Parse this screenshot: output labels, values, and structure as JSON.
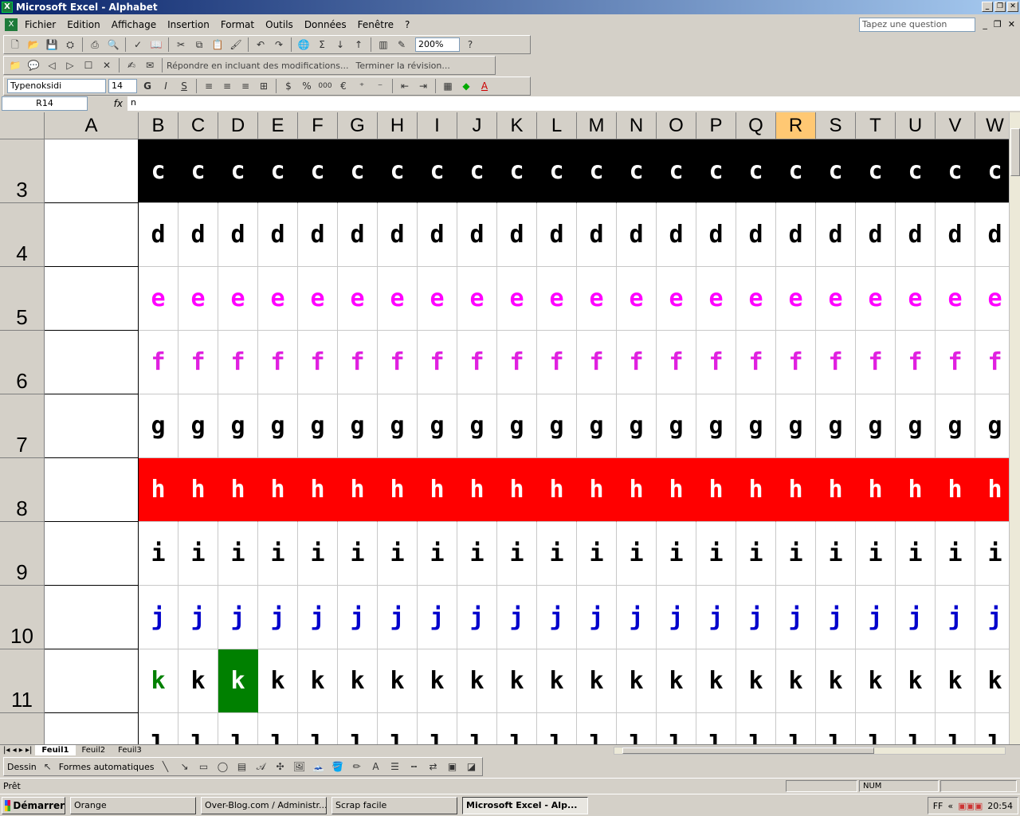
{
  "window": {
    "title": "Microsoft Excel - Alphabet"
  },
  "menu": [
    "Fichier",
    "Edition",
    "Affichage",
    "Insertion",
    "Format",
    "Outils",
    "Données",
    "Fenêtre",
    "?"
  ],
  "question_placeholder": "Tapez une question",
  "toolbar": {
    "zoom": "200%"
  },
  "review_toolbar": {
    "reply_label": "Répondre en incluant des modifications...",
    "end_label": "Terminer la révision..."
  },
  "format_toolbar": {
    "font": "Typenoksidi",
    "size": "14",
    "thousands": "000"
  },
  "formula_bar": {
    "name_box": "R14",
    "fx": "fx",
    "content": "n"
  },
  "columns": [
    "A",
    "B",
    "C",
    "D",
    "E",
    "F",
    "G",
    "H",
    "I",
    "J",
    "K",
    "L",
    "M",
    "N",
    "O",
    "P",
    "Q",
    "R",
    "S",
    "T",
    "U",
    "V",
    "W"
  ],
  "selected_column": "R",
  "rows": [
    {
      "num": "3",
      "letter": "c",
      "color": "#ffffff",
      "bg": "#000000"
    },
    {
      "num": "4",
      "letter": "d",
      "color": "#000000",
      "bg": "#ffffff"
    },
    {
      "num": "5",
      "letter": "e",
      "color": "#ff00ff",
      "bg": "#ffffff"
    },
    {
      "num": "6",
      "letter": "f",
      "color": "#e020e0",
      "bg": "#ffffff"
    },
    {
      "num": "7",
      "letter": "g",
      "color": "#000000",
      "bg": "#ffffff"
    },
    {
      "num": "8",
      "letter": "h",
      "color": "#ffffff",
      "bg": "#ff0000"
    },
    {
      "num": "9",
      "letter": "i",
      "color": "#000000",
      "bg": "#ffffff"
    },
    {
      "num": "10",
      "letter": "j",
      "color": "#0000cc",
      "bg": "#ffffff"
    },
    {
      "num": "11",
      "letter": "k",
      "color": "#000000",
      "bg": "#ffffff"
    },
    {
      "num": "",
      "letter": "l",
      "color": "#000000",
      "bg": "#ffffff"
    }
  ],
  "special_cells": [
    {
      "row": "11",
      "col": "B",
      "color": "#008000",
      "bg": "#ffffff"
    },
    {
      "row": "11",
      "col": "D",
      "color": "#ffffff",
      "bg": "#008000"
    }
  ],
  "sheet_tabs": [
    "Feuil1",
    "Feuil2",
    "Feuil3"
  ],
  "draw_toolbar": {
    "draw_label": "Dessin",
    "shapes_label": "Formes automatiques"
  },
  "status": {
    "ready": "Prêt",
    "num": "NUM"
  },
  "taskbar": {
    "start": "Démarrer",
    "tasks": [
      "Orange",
      "Over-Blog.com / Administr...",
      "Scrap facile",
      "Microsoft Excel - Alp..."
    ],
    "lang": "FF",
    "time": "20:54"
  }
}
